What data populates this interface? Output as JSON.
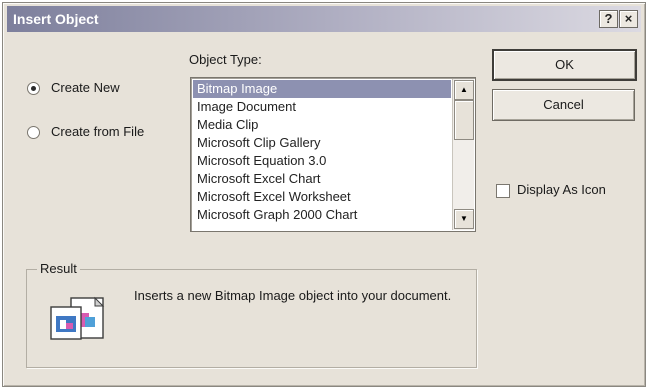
{
  "window": {
    "title": "Insert Object",
    "help_label": "?",
    "close_label": "×"
  },
  "options": {
    "create_new": "Create New",
    "create_from_file": "Create from File",
    "selected": "create_new"
  },
  "object_type": {
    "label": "Object Type:",
    "items": [
      "Bitmap Image",
      "Image Document",
      "Media Clip",
      "Microsoft Clip Gallery",
      "Microsoft Equation 3.0",
      "Microsoft Excel Chart",
      "Microsoft Excel Worksheet",
      "Microsoft Graph 2000 Chart"
    ],
    "selected_index": 0
  },
  "buttons": {
    "ok": "OK",
    "cancel": "Cancel"
  },
  "display_as_icon": {
    "label": "Display As Icon",
    "checked": false
  },
  "result": {
    "legend": "Result",
    "text": "Inserts a new Bitmap Image object into your document.",
    "icon": "insert-object-result-icon"
  },
  "colors": {
    "dialog_bg": "#e7e2d9",
    "title_bar_start": "#7d7f9c",
    "selection_bg": "#8d91b1"
  }
}
